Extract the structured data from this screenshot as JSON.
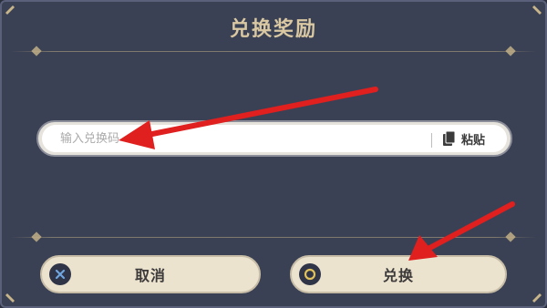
{
  "dialog": {
    "title": "兑换奖励"
  },
  "redeem_input": {
    "value": "",
    "placeholder": "输入兑换码"
  },
  "paste_button": {
    "label": "粘贴",
    "icon": "clipboard-icon"
  },
  "buttons": {
    "cancel": {
      "label": "取消",
      "icon": "close-icon"
    },
    "confirm": {
      "label": "兑换",
      "icon": "circle-icon"
    }
  },
  "annotations": {
    "arrow_color": "#e01f1f",
    "arrows": [
      "input-field-arrow",
      "confirm-button-arrow"
    ]
  },
  "colors": {
    "dialog_bg": "#3b4154",
    "title": "#d9c8a2",
    "button_bg": "#ece3cf",
    "accent_gold": "#e0c15a"
  }
}
